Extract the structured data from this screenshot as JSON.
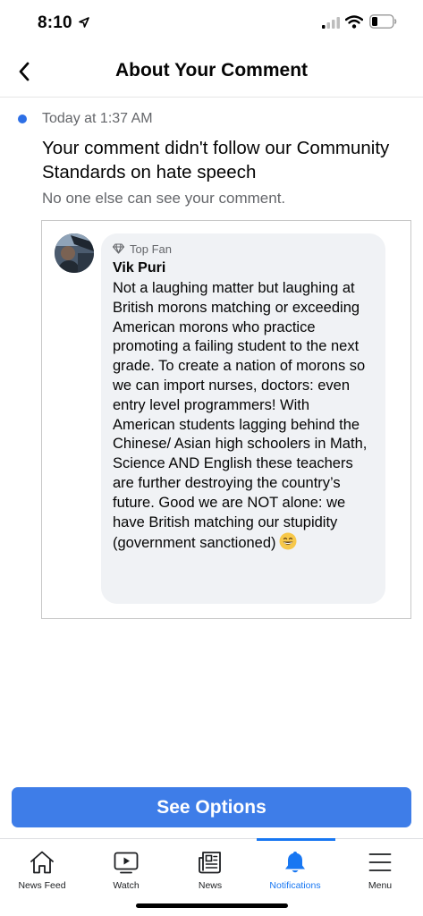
{
  "status_bar": {
    "time": "8:10",
    "icons": [
      "location-arrow-icon",
      "signal-icon",
      "wifi-icon",
      "battery-icon"
    ]
  },
  "header": {
    "title": "About Your Comment",
    "back_icon": "chevron-left-icon"
  },
  "notice": {
    "timestamp": "Today at 1:37 AM",
    "title": "Your comment didn't follow our Community Standards on hate speech",
    "subtitle": "No one else can see your comment."
  },
  "comment": {
    "badge": "Top Fan",
    "author": "Vik Puri",
    "text": "Not a laughing matter but laughing at British morons matching or exceeding American morons who practice promoting a failing student to the next grade. To create a nation of morons so we can import nurses, doctors: even entry level programmers! With American students lagging behind the Chinese/ Asian high schoolers in Math, Science AND English these teachers are further destroying the country’s future. Good we are NOT alone: we have British matching our stupidity (government sanctioned)",
    "emoji": "grinning-face-emoji"
  },
  "actions": {
    "see_options": "See Options"
  },
  "tabs": [
    {
      "label": "News Feed",
      "icon": "home-icon"
    },
    {
      "label": "Watch",
      "icon": "video-play-icon"
    },
    {
      "label": "News",
      "icon": "newspaper-icon"
    },
    {
      "label": "Notifications",
      "icon": "bell-icon",
      "active": true
    },
    {
      "label": "Menu",
      "icon": "hamburger-menu-icon"
    }
  ],
  "colors": {
    "accent": "#1877f2",
    "button": "#3e7de8",
    "unread_dot": "#2d6fe6",
    "bubble": "#f0f2f5",
    "secondary_text": "#65676b"
  }
}
